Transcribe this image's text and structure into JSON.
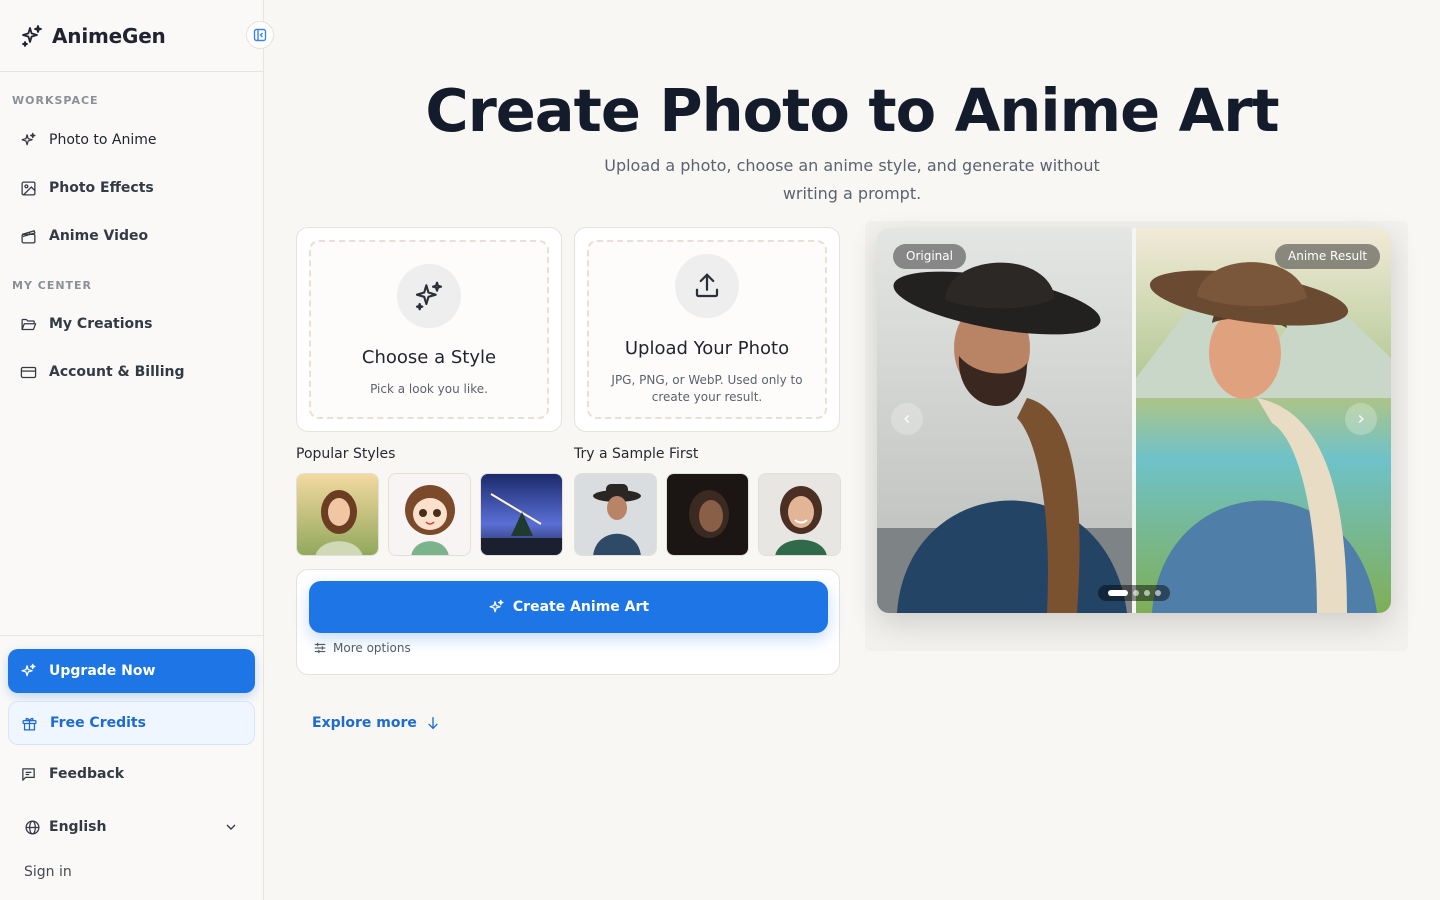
{
  "brand": {
    "name": "AnimeGen"
  },
  "sidebar": {
    "workspace_label": "WORKSPACE",
    "workspace_items": [
      {
        "label": "Photo to Anime",
        "icon": "sparkles-icon"
      },
      {
        "label": "Photo Effects",
        "icon": "image-icon"
      },
      {
        "label": "Anime Video",
        "icon": "clapperboard-icon"
      }
    ],
    "center_label": "MY CENTER",
    "center_items": [
      {
        "label": "My Creations",
        "icon": "folder-icon"
      },
      {
        "label": "Account & Billing",
        "icon": "credit-card-icon"
      }
    ],
    "upgrade_label": "Upgrade Now",
    "credits_label": "Free Credits",
    "feedback_label": "Feedback",
    "language": "English",
    "signin_label": "Sign in"
  },
  "hero": {
    "title": "Create Photo to Anime Art",
    "subtitle": "Upload a photo, choose an anime style, and generate without writing a prompt."
  },
  "style_card": {
    "title": "Choose a Style",
    "subtitle": "Pick a look you like."
  },
  "upload_card": {
    "title": "Upload Your Photo",
    "subtitle": "JPG, PNG, or WebP. Used only to create your result."
  },
  "popular_styles": {
    "label": "Popular Styles"
  },
  "samples": {
    "label": "Try a Sample First"
  },
  "actions": {
    "create_label": "Create Anime Art",
    "more_options_label": "More options",
    "explore_label": "Explore more"
  },
  "preview": {
    "original_label": "Original",
    "result_label": "Anime Result",
    "slides": 4,
    "active_slide": 1
  },
  "colors": {
    "accent": "#1d75e6",
    "text_dark": "#141b2b"
  }
}
